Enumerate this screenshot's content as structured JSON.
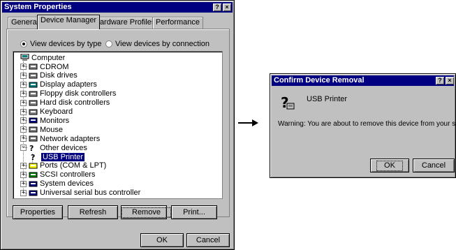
{
  "sysprops": {
    "title": "System Properties",
    "help_btn": "?",
    "close_btn": "×",
    "tabs": [
      "General",
      "Device Manager",
      "Hardware Profiles",
      "Performance"
    ],
    "radio_by_type": "View devices by type",
    "radio_by_connection": "View devices by connection",
    "tree": {
      "root": "Computer",
      "items": [
        {
          "label": "CDROM",
          "icon": "cdrom-icon"
        },
        {
          "label": "Disk drives",
          "icon": "disk-drive-icon"
        },
        {
          "label": "Display adapters",
          "icon": "display-adapter-icon"
        },
        {
          "label": "Floppy disk controllers",
          "icon": "floppy-controller-icon"
        },
        {
          "label": "Hard disk controllers",
          "icon": "hard-disk-controller-icon"
        },
        {
          "label": "Keyboard",
          "icon": "keyboard-icon"
        },
        {
          "label": "Monitors",
          "icon": "monitor-icon"
        },
        {
          "label": "Mouse",
          "icon": "mouse-icon"
        },
        {
          "label": "Network adapters",
          "icon": "network-adapter-icon"
        },
        {
          "label": "Other devices",
          "icon": "other-devices-icon",
          "expanded": true
        },
        {
          "label": "USB Printer",
          "icon": "unknown-device-icon",
          "child": true,
          "selected": true
        },
        {
          "label": "Ports (COM & LPT)",
          "icon": "ports-icon"
        },
        {
          "label": "SCSI controllers",
          "icon": "scsi-icon"
        },
        {
          "label": "System devices",
          "icon": "system-devices-icon"
        },
        {
          "label": "Universal serial bus controller",
          "icon": "usb-icon"
        }
      ]
    },
    "buttons": {
      "properties": "Properties",
      "refresh": "Refresh",
      "remove": "Remove",
      "print": "Print..."
    },
    "ok": "OK",
    "cancel": "Cancel"
  },
  "confirm": {
    "title": "Confirm Device Removal",
    "help_btn": "?",
    "close_btn": "×",
    "device_name": "USB Printer",
    "warning": "Warning: You are about to remove this device from your system.",
    "ok": "OK",
    "cancel": "Cancel"
  },
  "arrow": "→"
}
